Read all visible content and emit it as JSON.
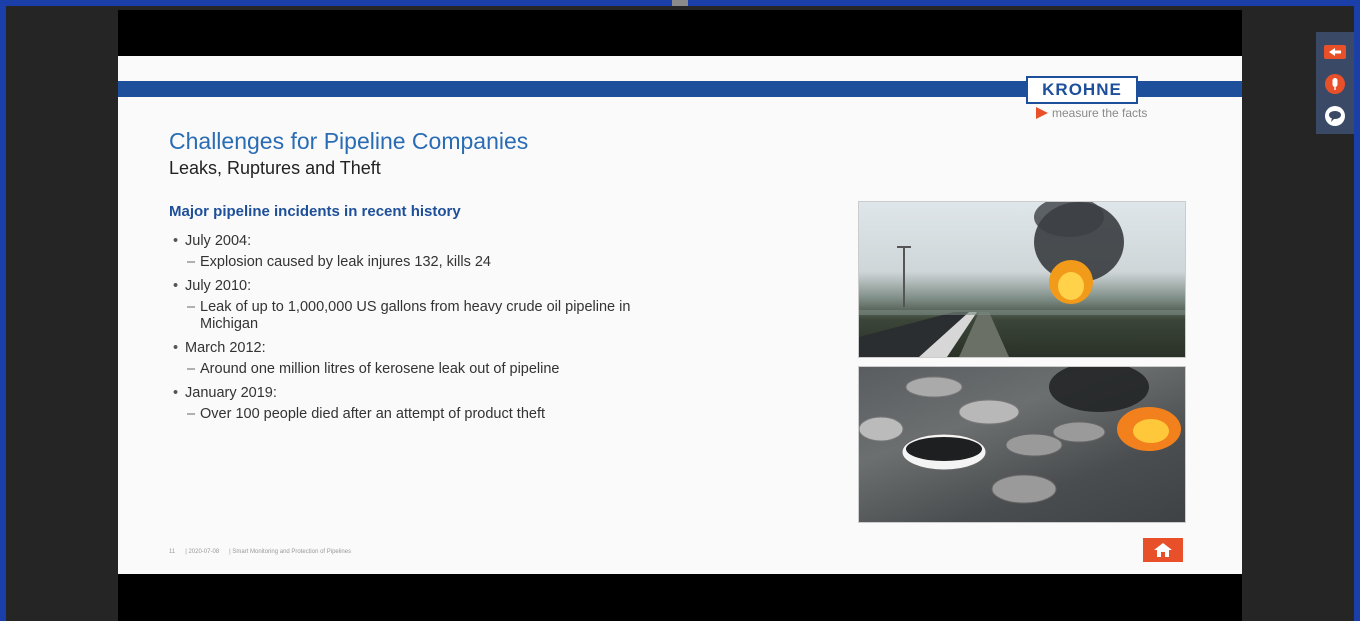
{
  "slide": {
    "logo": "KROHNE",
    "tagline": "measure the facts",
    "title": "Challenges for Pipeline Companies",
    "subtitle": "Leaks, Ruptures and Theft",
    "section_heading": "Major pipeline incidents in recent history",
    "incidents": [
      {
        "date": "July 2004:",
        "details": [
          "Explosion caused by leak injures 132, kills 24"
        ]
      },
      {
        "date": "July 2010:",
        "details": [
          "Leak of up to 1,000,000 US gallons from heavy crude oil pipeline in Michigan"
        ]
      },
      {
        "date": "March 2012:",
        "details": [
          "Around one million litres of kerosene leak out of pipeline"
        ]
      },
      {
        "date": "January 2019:",
        "details": [
          "Over 100 people died after an attempt of product theft"
        ]
      }
    ],
    "footer": {
      "page": "11",
      "date": "| 2020-07-08",
      "text": "| Smart Monitoring and Protection of Pipelines"
    }
  },
  "icons": {
    "home": "home-icon",
    "exit": "exit-icon",
    "mic": "microphone-icon",
    "chat": "chat-icon"
  },
  "colors": {
    "brand_blue": "#1e4f9a",
    "title_blue": "#2a6cb4",
    "accent_orange": "#e8502a",
    "outer_blue": "#1a3fa8"
  }
}
